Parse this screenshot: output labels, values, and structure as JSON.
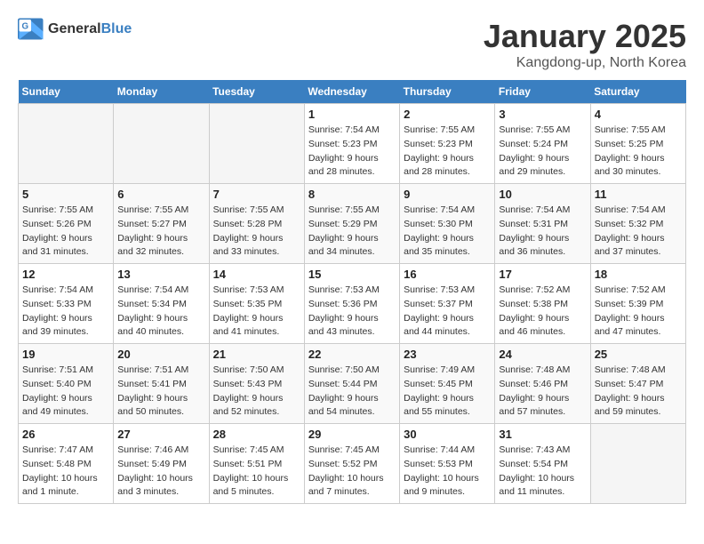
{
  "header": {
    "logo_general": "General",
    "logo_blue": "Blue",
    "month": "January 2025",
    "location": "Kangdong-up, North Korea"
  },
  "weekdays": [
    "Sunday",
    "Monday",
    "Tuesday",
    "Wednesday",
    "Thursday",
    "Friday",
    "Saturday"
  ],
  "weeks": [
    [
      {
        "day": "",
        "info": ""
      },
      {
        "day": "",
        "info": ""
      },
      {
        "day": "",
        "info": ""
      },
      {
        "day": "1",
        "info": "Sunrise: 7:54 AM\nSunset: 5:23 PM\nDaylight: 9 hours\nand 28 minutes."
      },
      {
        "day": "2",
        "info": "Sunrise: 7:55 AM\nSunset: 5:23 PM\nDaylight: 9 hours\nand 28 minutes."
      },
      {
        "day": "3",
        "info": "Sunrise: 7:55 AM\nSunset: 5:24 PM\nDaylight: 9 hours\nand 29 minutes."
      },
      {
        "day": "4",
        "info": "Sunrise: 7:55 AM\nSunset: 5:25 PM\nDaylight: 9 hours\nand 30 minutes."
      }
    ],
    [
      {
        "day": "5",
        "info": "Sunrise: 7:55 AM\nSunset: 5:26 PM\nDaylight: 9 hours\nand 31 minutes."
      },
      {
        "day": "6",
        "info": "Sunrise: 7:55 AM\nSunset: 5:27 PM\nDaylight: 9 hours\nand 32 minutes."
      },
      {
        "day": "7",
        "info": "Sunrise: 7:55 AM\nSunset: 5:28 PM\nDaylight: 9 hours\nand 33 minutes."
      },
      {
        "day": "8",
        "info": "Sunrise: 7:55 AM\nSunset: 5:29 PM\nDaylight: 9 hours\nand 34 minutes."
      },
      {
        "day": "9",
        "info": "Sunrise: 7:54 AM\nSunset: 5:30 PM\nDaylight: 9 hours\nand 35 minutes."
      },
      {
        "day": "10",
        "info": "Sunrise: 7:54 AM\nSunset: 5:31 PM\nDaylight: 9 hours\nand 36 minutes."
      },
      {
        "day": "11",
        "info": "Sunrise: 7:54 AM\nSunset: 5:32 PM\nDaylight: 9 hours\nand 37 minutes."
      }
    ],
    [
      {
        "day": "12",
        "info": "Sunrise: 7:54 AM\nSunset: 5:33 PM\nDaylight: 9 hours\nand 39 minutes."
      },
      {
        "day": "13",
        "info": "Sunrise: 7:54 AM\nSunset: 5:34 PM\nDaylight: 9 hours\nand 40 minutes."
      },
      {
        "day": "14",
        "info": "Sunrise: 7:53 AM\nSunset: 5:35 PM\nDaylight: 9 hours\nand 41 minutes."
      },
      {
        "day": "15",
        "info": "Sunrise: 7:53 AM\nSunset: 5:36 PM\nDaylight: 9 hours\nand 43 minutes."
      },
      {
        "day": "16",
        "info": "Sunrise: 7:53 AM\nSunset: 5:37 PM\nDaylight: 9 hours\nand 44 minutes."
      },
      {
        "day": "17",
        "info": "Sunrise: 7:52 AM\nSunset: 5:38 PM\nDaylight: 9 hours\nand 46 minutes."
      },
      {
        "day": "18",
        "info": "Sunrise: 7:52 AM\nSunset: 5:39 PM\nDaylight: 9 hours\nand 47 minutes."
      }
    ],
    [
      {
        "day": "19",
        "info": "Sunrise: 7:51 AM\nSunset: 5:40 PM\nDaylight: 9 hours\nand 49 minutes."
      },
      {
        "day": "20",
        "info": "Sunrise: 7:51 AM\nSunset: 5:41 PM\nDaylight: 9 hours\nand 50 minutes."
      },
      {
        "day": "21",
        "info": "Sunrise: 7:50 AM\nSunset: 5:43 PM\nDaylight: 9 hours\nand 52 minutes."
      },
      {
        "day": "22",
        "info": "Sunrise: 7:50 AM\nSunset: 5:44 PM\nDaylight: 9 hours\nand 54 minutes."
      },
      {
        "day": "23",
        "info": "Sunrise: 7:49 AM\nSunset: 5:45 PM\nDaylight: 9 hours\nand 55 minutes."
      },
      {
        "day": "24",
        "info": "Sunrise: 7:48 AM\nSunset: 5:46 PM\nDaylight: 9 hours\nand 57 minutes."
      },
      {
        "day": "25",
        "info": "Sunrise: 7:48 AM\nSunset: 5:47 PM\nDaylight: 9 hours\nand 59 minutes."
      }
    ],
    [
      {
        "day": "26",
        "info": "Sunrise: 7:47 AM\nSunset: 5:48 PM\nDaylight: 10 hours\nand 1 minute."
      },
      {
        "day": "27",
        "info": "Sunrise: 7:46 AM\nSunset: 5:49 PM\nDaylight: 10 hours\nand 3 minutes."
      },
      {
        "day": "28",
        "info": "Sunrise: 7:45 AM\nSunset: 5:51 PM\nDaylight: 10 hours\nand 5 minutes."
      },
      {
        "day": "29",
        "info": "Sunrise: 7:45 AM\nSunset: 5:52 PM\nDaylight: 10 hours\nand 7 minutes."
      },
      {
        "day": "30",
        "info": "Sunrise: 7:44 AM\nSunset: 5:53 PM\nDaylight: 10 hours\nand 9 minutes."
      },
      {
        "day": "31",
        "info": "Sunrise: 7:43 AM\nSunset: 5:54 PM\nDaylight: 10 hours\nand 11 minutes."
      },
      {
        "day": "",
        "info": ""
      }
    ]
  ]
}
